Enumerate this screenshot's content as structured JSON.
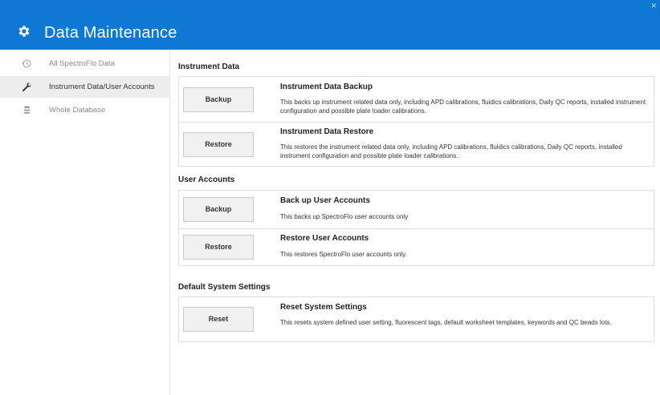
{
  "header": {
    "title": "Data Maintenance",
    "icon": "gear-icon"
  },
  "sidebar": {
    "items": [
      {
        "label": "All SpectroFlo Data",
        "icon": "restore-clock-icon",
        "active": false
      },
      {
        "label": "Instrument Data/User Accounts",
        "icon": "wrench-icon",
        "active": true
      },
      {
        "label": "Whole Database",
        "icon": "database-icon",
        "active": false
      }
    ]
  },
  "sections": {
    "instrument": {
      "title": "Instrument Data",
      "rows": [
        {
          "button": "Backup",
          "title": "Instrument Data Backup",
          "desc": "This backs up instrument related data only, including APD calibrations, fluidics calibrations, Daily QC reports, installed instrument configuration and possible plate loader calibrations."
        },
        {
          "button": "Restore",
          "title": "Instrument Data Restore",
          "desc": "This restores the instrument related data only, including APD calibrations, fluidics calibrations, Daily QC reports, installed instrument configuration and possible plate loader calibrations."
        }
      ]
    },
    "users": {
      "title": "User Accounts",
      "rows": [
        {
          "button": "Backup",
          "title": "Back up User Accounts",
          "desc": "This backs up SpectroFlo user accounts only"
        },
        {
          "button": "Restore",
          "title": "Restore User Accounts",
          "desc": "This restores SpectroFlo user accounts only."
        }
      ]
    },
    "defaults": {
      "title": "Default System Settings",
      "rows": [
        {
          "button": "Reset",
          "title": "Reset System Settings",
          "desc": "This resets system defined user setting, fluorescent tags, default worksheet templates, keywords and QC beads lots."
        }
      ]
    }
  },
  "colors": {
    "header": "#0e78d4",
    "active_item": "#ededed",
    "button": "#f0f0f0"
  }
}
